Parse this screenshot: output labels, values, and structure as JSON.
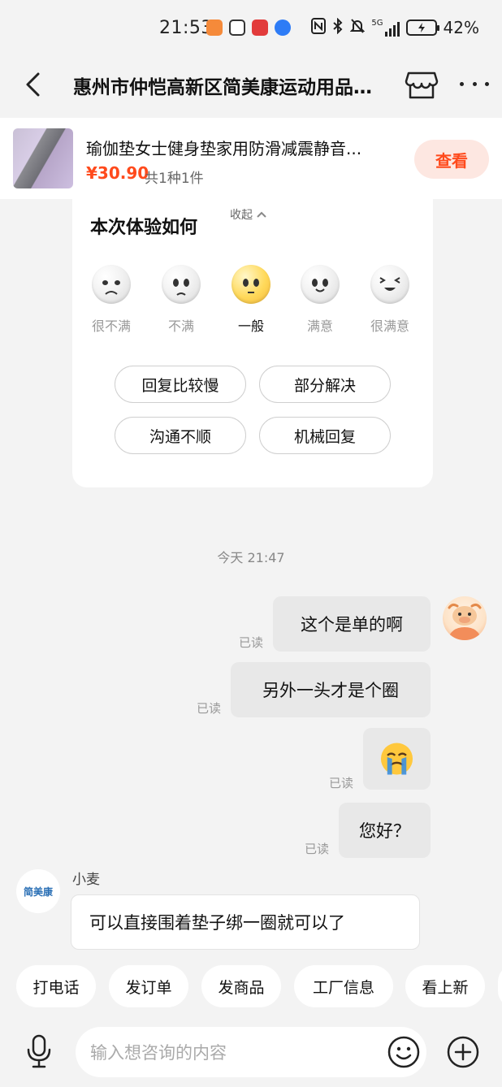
{
  "status_bar": {
    "time": "21:53",
    "network": "5G",
    "battery": "42%"
  },
  "header": {
    "title": "惠州市仲恺高新区简美康运动用品..."
  },
  "product": {
    "name": "瑜伽垫女士健身垫家用防滑减震静音...",
    "price": "¥30.90",
    "quantity": "共1种1件",
    "view_label": "查看"
  },
  "survey": {
    "title": "本次体验如何",
    "collapse_label": "收起",
    "ratings": [
      {
        "label": "很不满",
        "selected": false
      },
      {
        "label": "不满",
        "selected": false
      },
      {
        "label": "一般",
        "selected": true
      },
      {
        "label": "满意",
        "selected": false
      },
      {
        "label": "很满意",
        "selected": false
      }
    ],
    "tags": [
      "回复比较慢",
      "部分解决",
      "沟通不顺",
      "机械回复"
    ]
  },
  "chat": {
    "timestamp": "今天 21:47",
    "read_label": "已读",
    "outgoing": [
      {
        "text": "这个是单的啊"
      },
      {
        "text": "另外一头才是个圈"
      },
      {
        "text": "😭"
      },
      {
        "text": "您好？"
      }
    ],
    "incoming": {
      "sender": "小麦",
      "avatar_text": "简美康",
      "text": "可以直接围着垫子绑一圈就可以了"
    }
  },
  "quick_actions": [
    "打电话",
    "发订单",
    "发商品",
    "工厂信息",
    "看上新"
  ],
  "input": {
    "placeholder": "输入想咨询的内容"
  },
  "colors": {
    "accent": "#ff4a1c",
    "accent_bg": "#fde7e1",
    "background": "#f3f3f3"
  }
}
